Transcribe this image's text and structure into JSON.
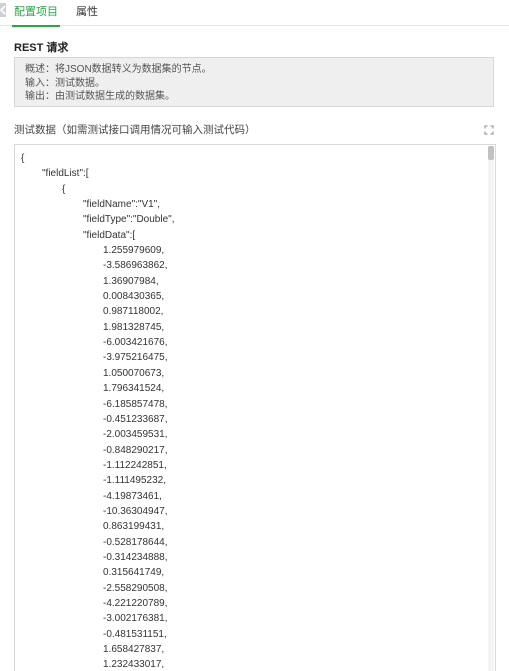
{
  "tabs": [
    {
      "label": "配置项目",
      "active": true
    },
    {
      "label": "属性",
      "active": false
    }
  ],
  "section_title": "REST 请求",
  "description": {
    "lines": [
      "概述：将JSON数据转义为数据集的节点。",
      "输入：测试数据。",
      "输出：由测试数据生成的数据集。"
    ]
  },
  "test_data": {
    "label": "测试数据（如需测试接口调用情况可输入测试代码）",
    "expand_icon": "expand-icon",
    "code_lines": [
      {
        "indent": 0,
        "text": "{"
      },
      {
        "indent": 1,
        "text": "\"fieldList\":["
      },
      {
        "indent": 2,
        "text": "{"
      },
      {
        "indent": 3,
        "text": "\"fieldName\":\"V1\","
      },
      {
        "indent": 3,
        "text": "\"fieldType\":\"Double\","
      },
      {
        "indent": 3,
        "text": "\"fieldData\":["
      },
      {
        "indent": 4,
        "text": "1.255979609,"
      },
      {
        "indent": 4,
        "text": "-3.586963862,"
      },
      {
        "indent": 4,
        "text": "1.36907984,"
      },
      {
        "indent": 4,
        "text": "0.008430365,"
      },
      {
        "indent": 4,
        "text": "0.987118002,"
      },
      {
        "indent": 4,
        "text": "1.981328745,"
      },
      {
        "indent": 4,
        "text": "-6.003421676,"
      },
      {
        "indent": 4,
        "text": "-3.975216475,"
      },
      {
        "indent": 4,
        "text": "1.050070673,"
      },
      {
        "indent": 4,
        "text": "1.796341524,"
      },
      {
        "indent": 4,
        "text": "-6.185857478,"
      },
      {
        "indent": 4,
        "text": "-0.451233687,"
      },
      {
        "indent": 4,
        "text": "-2.003459531,"
      },
      {
        "indent": 4,
        "text": "-0.848290217,"
      },
      {
        "indent": 4,
        "text": "-1.112242851,"
      },
      {
        "indent": 4,
        "text": "-1.111495232,"
      },
      {
        "indent": 4,
        "text": "-4.19873461,"
      },
      {
        "indent": 4,
        "text": "-10.36304947,"
      },
      {
        "indent": 4,
        "text": "0.863199431,"
      },
      {
        "indent": 4,
        "text": "-0.528178644,"
      },
      {
        "indent": 4,
        "text": "-0.314234888,"
      },
      {
        "indent": 4,
        "text": "0.315641749,"
      },
      {
        "indent": 4,
        "text": "-2.558290508,"
      },
      {
        "indent": 4,
        "text": "-4.221220789,"
      },
      {
        "indent": 4,
        "text": "-3.002176381,"
      },
      {
        "indent": 4,
        "text": "-0.481531151,"
      },
      {
        "indent": 4,
        "text": "1.658427837,"
      },
      {
        "indent": 4,
        "text": "1.232433017,"
      }
    ]
  },
  "colors": {
    "accent": "#28a745",
    "desc_bg": "#efefef",
    "border": "#d9d9d9"
  }
}
